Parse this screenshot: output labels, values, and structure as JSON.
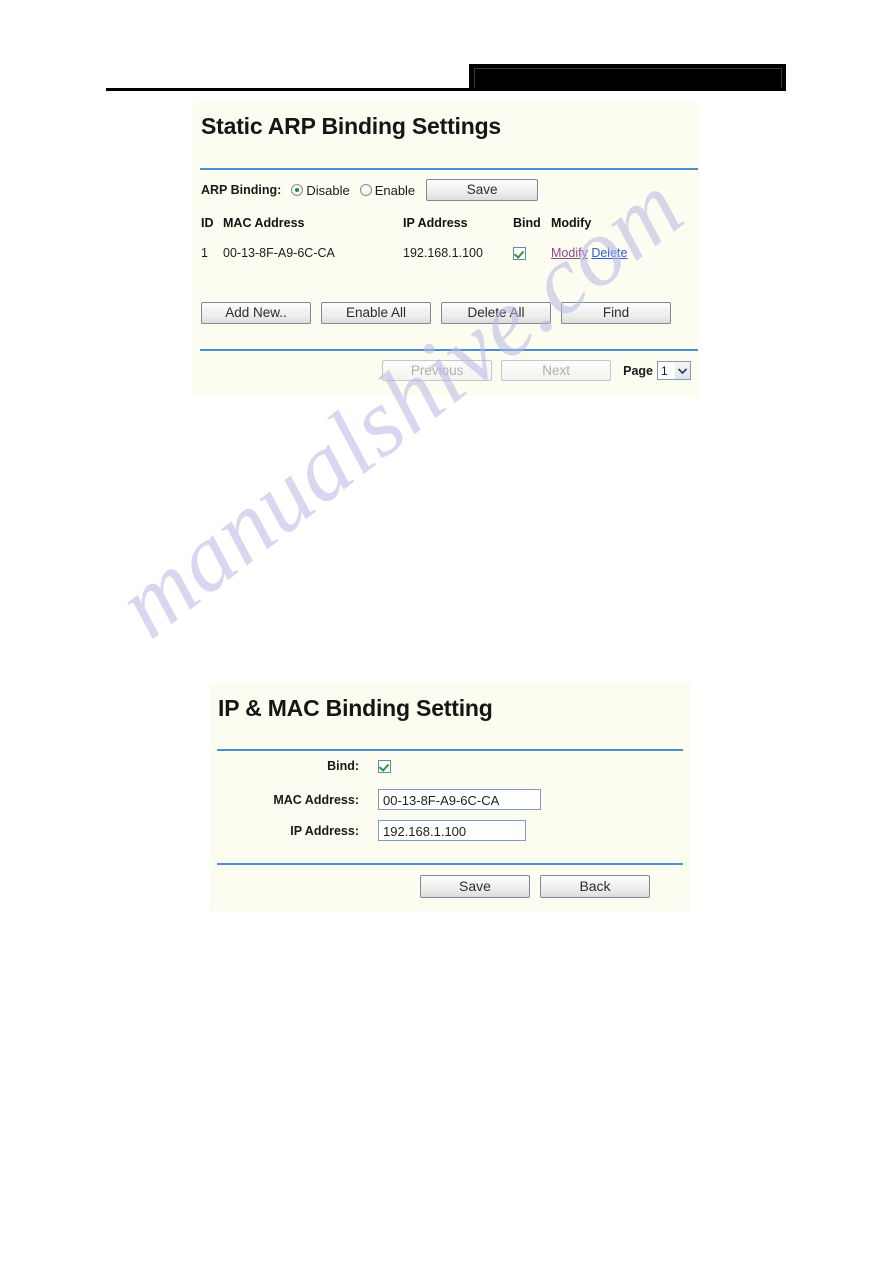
{
  "header": {
    "redaction_bar": "",
    "rule": ""
  },
  "watermark": {
    "text": "manualshive.com"
  },
  "colors": {
    "panel_background": "#FCFCF0",
    "divider_blue": "#4B8FD0",
    "link_visited": "#8D4B8D",
    "link_unvisited": "#2B5FD9",
    "check_green": "#2F9A33",
    "radio_green": "#2E8B2E",
    "page_background": "#FFFFFF"
  },
  "arp_panel": {
    "title": "Static ARP Binding Settings",
    "arp_binding": {
      "label": "ARP Binding:",
      "options": [
        {
          "label": "Disable",
          "selected": true
        },
        {
          "label": "Enable",
          "selected": false
        }
      ],
      "save_label": "Save"
    },
    "table": {
      "headers": [
        "ID",
        "MAC Address",
        "IP Address",
        "Bind",
        "Modify"
      ],
      "rows": [
        {
          "id": "1",
          "mac_address": "00-13-8F-A9-6C-CA",
          "ip_address": "192.168.1.100",
          "bind_checked": true,
          "modify_label": "Modify",
          "delete_label": "Delete"
        }
      ]
    },
    "actions": [
      {
        "label": "Add New..",
        "disabled": false
      },
      {
        "label": "Enable All",
        "disabled": false
      },
      {
        "label": "Delete All",
        "disabled": false
      },
      {
        "label": "Find",
        "disabled": false
      }
    ],
    "pagination": {
      "previous_label": "Previous",
      "previous_disabled": true,
      "next_label": "Next",
      "next_disabled": true,
      "page_label": "Page",
      "page_value": "1",
      "page_options": [
        "1"
      ]
    }
  },
  "bind_panel": {
    "title": "IP & MAC Binding Setting",
    "fields": {
      "bind": {
        "label": "Bind:",
        "checked": true
      },
      "mac_address": {
        "label": "MAC Address:",
        "value": "00-13-8F-A9-6C-CA"
      },
      "ip_address": {
        "label": "IP Address:",
        "value": "192.168.1.100"
      }
    },
    "buttons": {
      "save_label": "Save",
      "back_label": "Back"
    }
  }
}
